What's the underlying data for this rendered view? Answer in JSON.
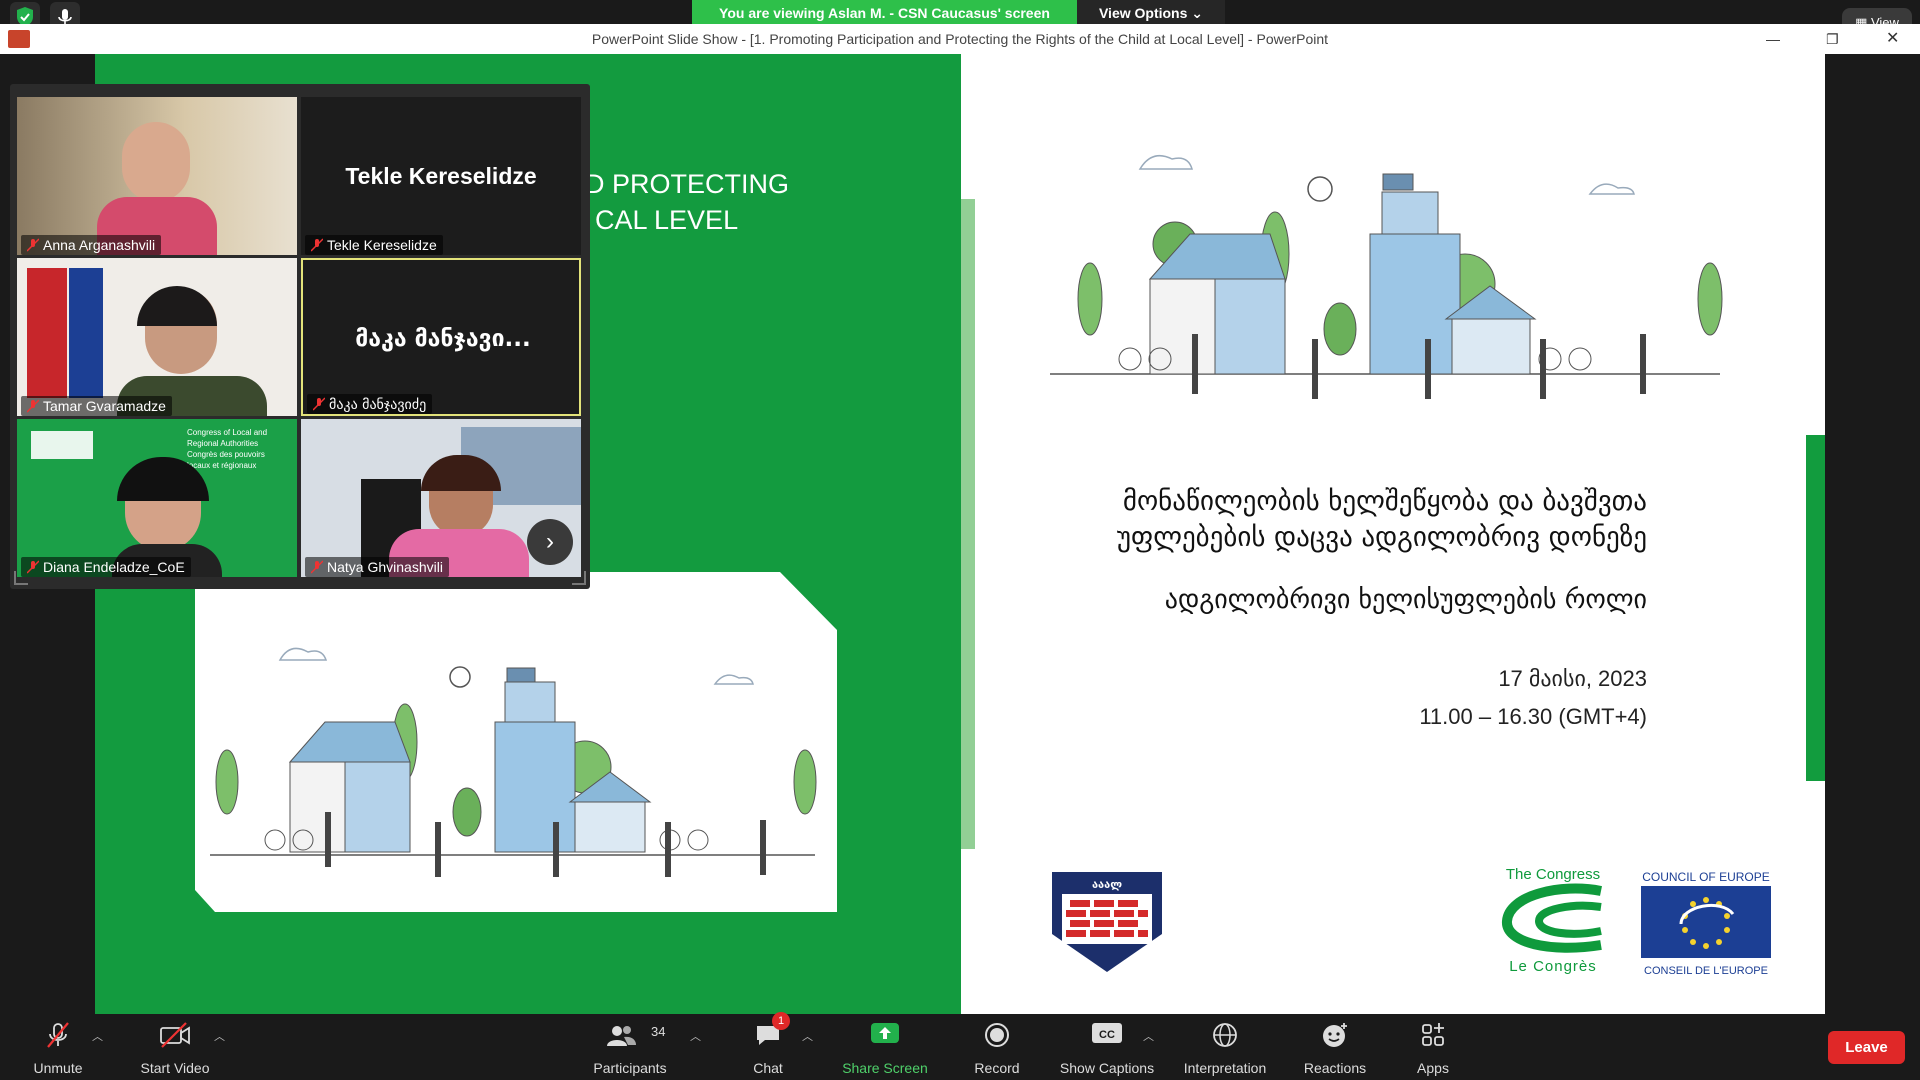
{
  "zoom": {
    "banner_text": "You are viewing Aslan M. - CSN Caucasus' screen",
    "view_options_label": "View Options",
    "view_label": "View"
  },
  "powerpoint": {
    "window_title": "PowerPoint Slide Show - [1. Promoting Participation and Protecting the Rights of the Child at Local Level] - PowerPoint"
  },
  "slide": {
    "title_line1": "D PROTECTING",
    "title_line2": "CAL LEVEL",
    "georgian_title_line1": "მონაწილეობის ხელშეწყობა და ბავშვთა",
    "georgian_title_line2": "უფლებების დაცვა ადგილობრივ დონეზე",
    "georgian_subtitle": "ადგილობრივი ხელისუფლების როლი",
    "date": "17 მაისი, 2023",
    "time": "11.00 – 16.30 (GMT+4)",
    "logos": {
      "naala_text": "ააალ",
      "congress_top": "The Congress",
      "congress_bottom": "Le Congrès",
      "coe_top": "COUNCIL OF EUROPE",
      "coe_bottom": "CONSEIL DE L'EUROPE",
      "coe_color": "#1c3f94",
      "congress_color": "#0f9a3c"
    },
    "left_bg_color": "#139b3f"
  },
  "gallery": {
    "participants": [
      {
        "name": "Anna Arganashvili",
        "video": true
      },
      {
        "name": "Tekle Kereselidze",
        "video": false,
        "display": "Tekle Kereselidze"
      },
      {
        "name": "Tamar Gvaramadze",
        "video": true
      },
      {
        "name": "მაკა მანჯავიძე",
        "video": false,
        "display": "მაკა მანჯავი..."
      },
      {
        "name": "Diana Endeladze_CoE",
        "video": true
      },
      {
        "name": "Natya Ghvinashvili",
        "video": true
      }
    ],
    "diana_bg_lines": [
      "Congress of Local and",
      "Regional Authorities",
      "Congrès des pouvoirs",
      "locaux et régionaux"
    ],
    "active_speaker_border": "#e3e37a"
  },
  "toolbar": {
    "unmute": "Unmute",
    "start_video": "Start Video",
    "participants": "Participants",
    "participants_count": "34",
    "chat": "Chat",
    "chat_badge": "1",
    "share_screen": "Share Screen",
    "record": "Record",
    "show_captions": "Show Captions",
    "captions_icon_text": "CC",
    "interpretation": "Interpretation",
    "reactions": "Reactions",
    "apps": "Apps",
    "leave": "Leave"
  }
}
